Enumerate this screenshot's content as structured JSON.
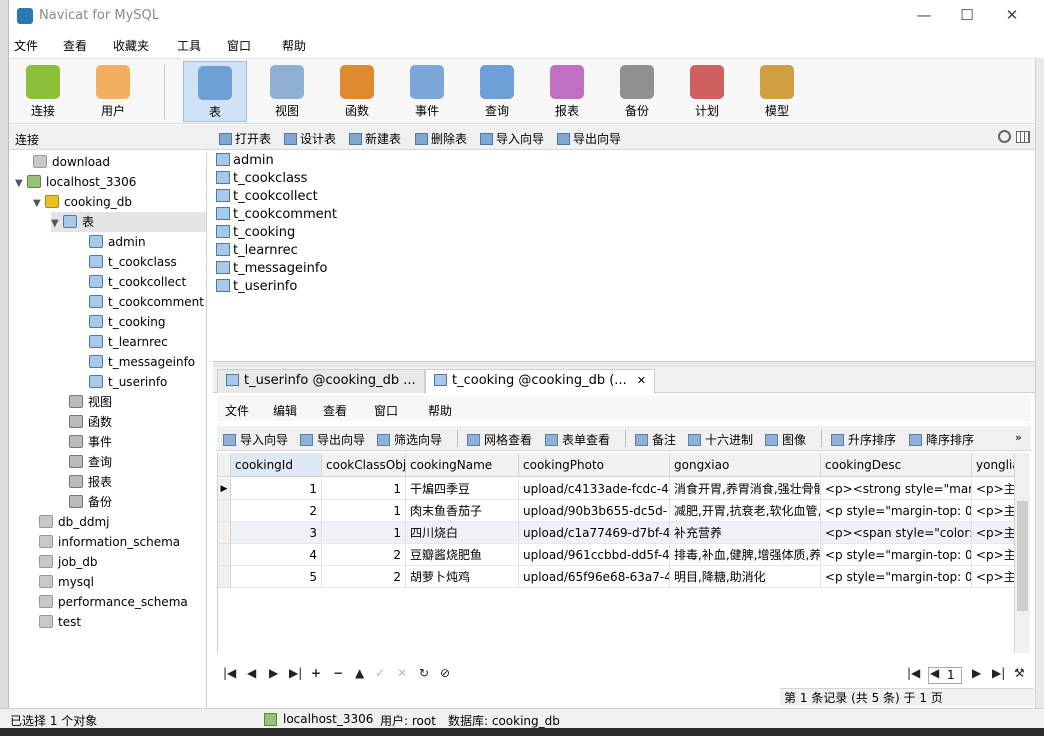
{
  "window": {
    "title": "Navicat for MySQL",
    "controls": [
      "—",
      "☐",
      "✕"
    ]
  },
  "menu": [
    "文件",
    "查看",
    "收藏夹",
    "工具",
    "窗口",
    "帮助"
  ],
  "toolbar": [
    {
      "label": "连接",
      "icon": "plug-icon",
      "color": "#8cbf3a"
    },
    {
      "label": "用户",
      "icon": "user-icon",
      "color": "#f0b060"
    },
    {
      "label": "表",
      "icon": "table-icon",
      "color": "#6ea0d6",
      "selected": true
    },
    {
      "label": "视图",
      "icon": "view-icon",
      "color": "#8fb0d0"
    },
    {
      "label": "函数",
      "icon": "function-icon",
      "color": "#e08a30"
    },
    {
      "label": "事件",
      "icon": "event-icon",
      "color": "#7aa7d8"
    },
    {
      "label": "查询",
      "icon": "query-icon",
      "color": "#6e9fd6"
    },
    {
      "label": "报表",
      "icon": "report-icon",
      "color": "#c070c0"
    },
    {
      "label": "备份",
      "icon": "backup-icon",
      "color": "#909090"
    },
    {
      "label": "计划",
      "icon": "schedule-icon",
      "color": "#d06060"
    },
    {
      "label": "模型",
      "icon": "model-icon",
      "color": "#d0a040"
    }
  ],
  "subbar": {
    "connection_label": "连接",
    "buttons": [
      "打开表",
      "设计表",
      "新建表",
      "删除表",
      "导入向导",
      "导出向导"
    ]
  },
  "tree": {
    "download": "download",
    "server": "localhost_3306",
    "db": "cooking_db",
    "tables_node": "表",
    "tables": [
      "admin",
      "t_cookclass",
      "t_cookcollect",
      "t_cookcomment",
      "t_cooking",
      "t_learnrec",
      "t_messageinfo",
      "t_userinfo"
    ],
    "db_children": [
      "视图",
      "函数",
      "事件",
      "查询",
      "报表",
      "备份"
    ],
    "other_dbs": [
      "db_ddmj",
      "information_schema",
      "job_db",
      "mysql",
      "performance_schema",
      "test"
    ]
  },
  "object_list": [
    "admin",
    "t_cookclass",
    "t_cookcollect",
    "t_cookcomment",
    "t_cooking",
    "t_learnrec",
    "t_messageinfo",
    "t_userinfo"
  ],
  "tabs": [
    {
      "label": "t_userinfo @cooking_db ...",
      "active": false
    },
    {
      "label": "t_cooking @cooking_db (...",
      "active": true,
      "close": "✕"
    }
  ],
  "inner_menu": [
    "文件",
    "编辑",
    "查看",
    "窗口",
    "帮助"
  ],
  "inner_toolbar": [
    "导入向导",
    "导出向导",
    "筛选向导",
    "网格查看",
    "表单查看",
    "备注",
    "十六进制",
    "图像",
    "升序排序",
    "降序排序"
  ],
  "grid": {
    "columns": [
      "cookingId",
      "cookClassObj",
      "cookingName",
      "cookingPhoto",
      "gongxiao",
      "cookingDesc",
      "yonglia"
    ],
    "rows": [
      [
        "1",
        "1",
        "干煸四季豆",
        "upload/c4133ade-fcdc-4",
        "消食开胃,养胃消食,强壮骨骼",
        "<p><strong style=\"marg",
        "<p>主"
      ],
      [
        "2",
        "1",
        "肉末鱼香茄子",
        "upload/90b3b655-dc5d-",
        "减肥,开胃,抗衰老,软化血管,",
        "<p style=\"margin-top: 0p",
        "<p>主"
      ],
      [
        "3",
        "1",
        "四川烧白",
        "upload/c1a77469-d7bf-4",
        "补充营养",
        "<p><span style=\"color: r",
        "<p>主"
      ],
      [
        "4",
        "2",
        "豆瓣酱烧肥鱼",
        "upload/961ccbbd-dd5f-4",
        "排毒,补血,健脾,增强体质,养胃",
        "<p style=\"margin-top: 0p",
        "<p>主"
      ],
      [
        "5",
        "2",
        "胡萝卜炖鸡",
        "upload/65f96e68-63a7-4",
        "明目,降糖,助消化",
        "<p style=\"margin-top: 0p",
        "<p>主"
      ]
    ],
    "current_row_marker": "▶"
  },
  "navigator": {
    "buttons": [
      "|◀",
      "◀",
      "▶",
      "▶|",
      "+",
      "−",
      "▲",
      "✓",
      "✕",
      "↻",
      "⊘"
    ],
    "page": "1",
    "right_buttons": [
      "|◀",
      "◀",
      "▶",
      "▶|",
      "⚒"
    ]
  },
  "record_info": "第 1 条记录 (共 5 条) 于 1 页",
  "status": {
    "selected": "已选择 1 个对象",
    "server": "localhost_3306",
    "user": "用户: root",
    "db": "数据库: cooking_db"
  }
}
